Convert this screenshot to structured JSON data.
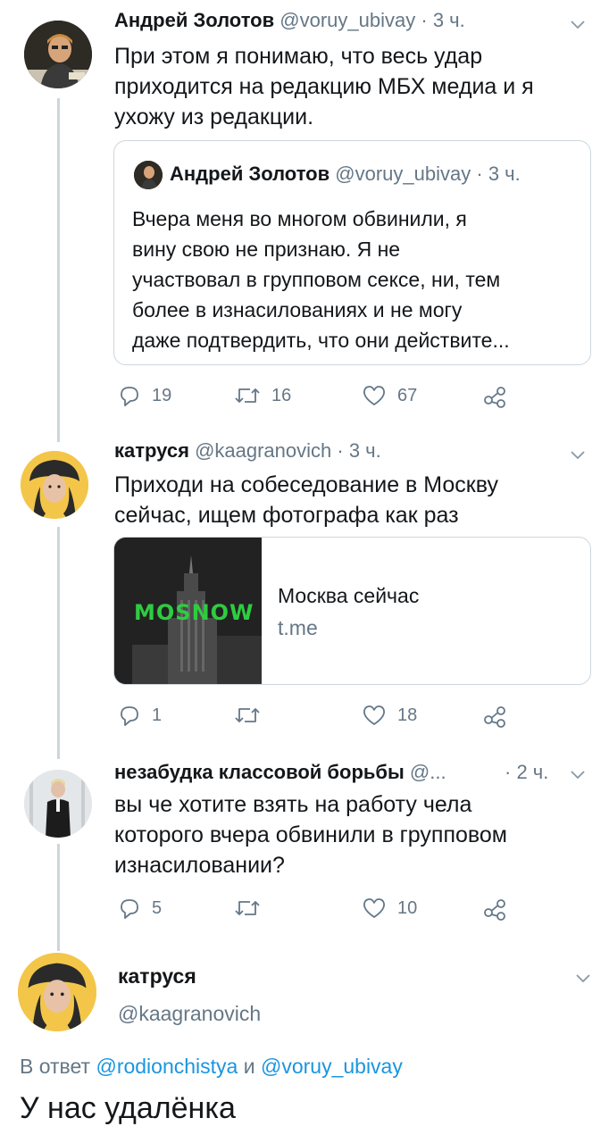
{
  "tweets": [
    {
      "name": "Андрей Золотов",
      "handle": "@voruy_ubivay",
      "time": "· 3 ч.",
      "lines": [
        "При этом я понимаю, что весь удар",
        "приходится на редакцию МБХ медиа и я",
        "ухожу из редакции."
      ],
      "quote": {
        "name": "Андрей Золотов",
        "handle": "@voruy_ubivay",
        "time": "· 3 ч.",
        "lines": [
          "Вчера меня во многом обвинили, я",
          "вину свою не признаю. Я не",
          "участвовал в групповом сексе, ни, тем",
          "более в изнасилованиях и не могу",
          "даже подтвердить, что они действите..."
        ]
      },
      "replies": "19",
      "retweets": "16",
      "likes": "67"
    },
    {
      "name": "катруся",
      "handle": "@kaagranovich",
      "time": "· 3 ч.",
      "lines": [
        "Приходи на собеседование в Москву",
        "сейчас, ищем фотографа как раз"
      ],
      "card": {
        "image_label": "MOSNOW",
        "title": "Москва сейчас",
        "domain": "t.me"
      },
      "replies": "1",
      "retweets": "",
      "likes": "18"
    },
    {
      "name": "незабудка классовой борьбы",
      "handle": "@...",
      "time": "· 2 ч.",
      "lines": [
        "вы че хотите взять на работу чела",
        "которого вчера обвинили в групповом",
        "изнасиловании?"
      ],
      "replies": "5",
      "retweets": "",
      "likes": "10"
    }
  ],
  "main": {
    "name": "катруся",
    "handle": "@kaagranovich",
    "reply_prefix": "В ответ",
    "reply_user1": "@rodionchistya",
    "reply_and": "и",
    "reply_user2": "@voruy_ubivay",
    "text": "У нас удалёнка"
  },
  "icons": {
    "reply": "reply-icon",
    "retweet": "retweet-icon",
    "like": "heart-icon",
    "share": "share-icon",
    "more": "chevron-down-icon"
  },
  "colors": {
    "link": "#1b95e0",
    "muted": "#657786",
    "thread_line": "#ccd6dd",
    "mosnow_green": "#2ecc40"
  }
}
